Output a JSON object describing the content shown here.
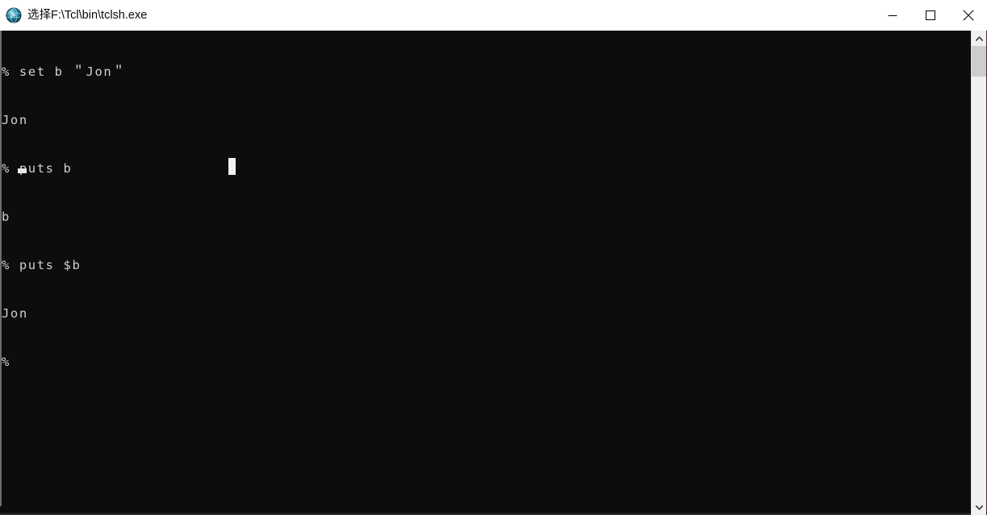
{
  "window": {
    "title": "选择F:\\Tcl\\bin\\tclsh.exe",
    "icon": "tcl-globe-icon",
    "titlebar_background": "#ffffff",
    "titlebar_text_color": "#0a0a0a",
    "controls": {
      "minimize_label": "—",
      "minimize_icon": "minimize-icon",
      "maximize_label": "□",
      "maximize_icon": "maximize-icon",
      "close_label": "✕",
      "close_icon": "close-icon"
    }
  },
  "console": {
    "background": "#0d0d0d",
    "foreground": "#cfcfcf",
    "lines": [
      "% set b ＂Jon＂",
      "Jon",
      "% puts b",
      "b",
      "% puts $b",
      "Jon",
      "% "
    ],
    "caret": {
      "type": "underline",
      "color": "#e8e8e8"
    },
    "block_cursor": {
      "type": "block",
      "color": "#f1f1f1"
    }
  },
  "scrollbar": {
    "up_icon": "chevron-up-icon",
    "down_icon": "chevron-down-icon",
    "thumb_color": "#cdcdcd",
    "track_color": "#f0f0f0"
  }
}
